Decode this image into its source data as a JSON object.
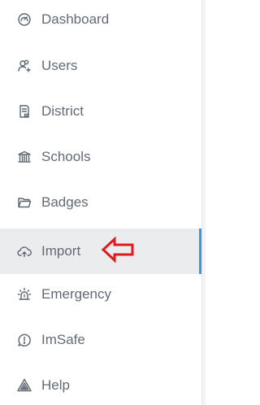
{
  "sidebar": {
    "items": [
      {
        "label": "Dashboard",
        "icon": "dashboard-gauge-icon",
        "active": false
      },
      {
        "label": "Users",
        "icon": "users-add-icon",
        "active": false
      },
      {
        "label": "District",
        "icon": "district-document-icon",
        "active": false
      },
      {
        "label": "Schools",
        "icon": "school-building-icon",
        "active": false
      },
      {
        "label": "Badges",
        "icon": "folder-icon",
        "active": false
      },
      {
        "label": "Import",
        "icon": "cloud-upload-icon",
        "active": true
      },
      {
        "label": "Emergency",
        "icon": "alarm-siren-icon",
        "active": false
      },
      {
        "label": "ImSafe",
        "icon": "alert-circle-icon",
        "active": false
      },
      {
        "label": "Help",
        "icon": "warning-triangle-icon",
        "active": false
      }
    ]
  },
  "annotation": {
    "arrow_color": "#e1191e",
    "points_to": "Import"
  },
  "colors": {
    "text": "#636a73",
    "icon": "#5d6670",
    "active_background": "#ebecee",
    "active_indicator": "#3f97d6"
  }
}
